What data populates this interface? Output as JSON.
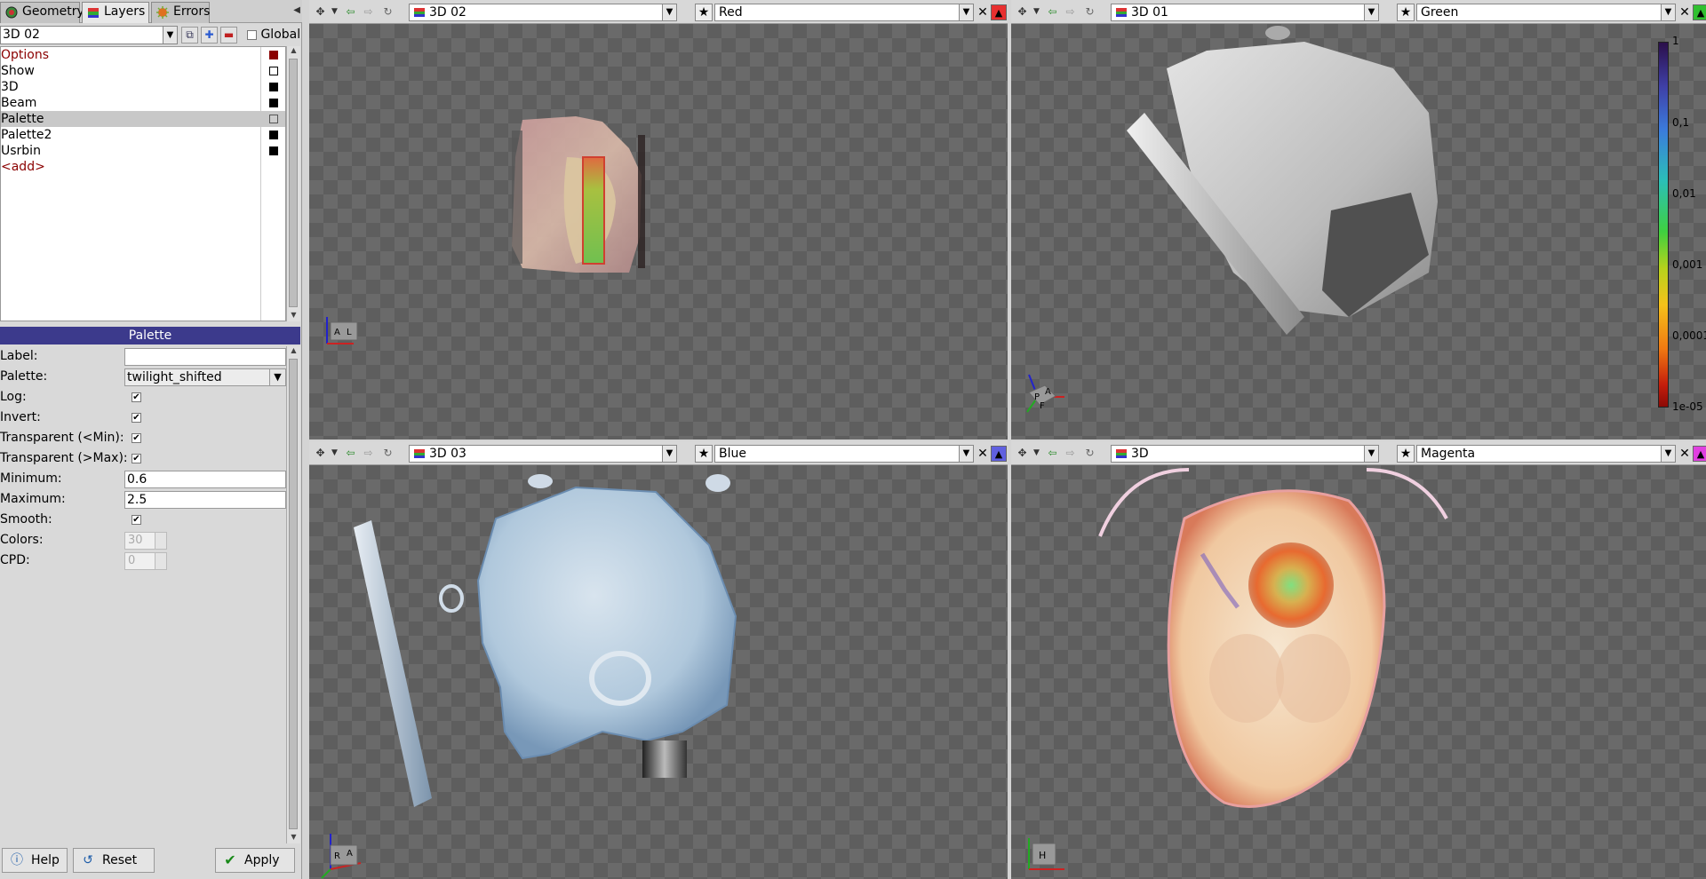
{
  "left_panel": {
    "tabs": [
      {
        "label": "Geometry",
        "icon": "geometry-icon"
      },
      {
        "label": "Layers",
        "icon": "layers-icon"
      },
      {
        "label": "Errors",
        "icon": "errors-icon"
      }
    ],
    "layer_select": "3D 02",
    "global_label": "Global",
    "layers": [
      {
        "label": "Options",
        "color": "#8b0000"
      },
      {
        "label": "Show",
        "color": "#ffffff"
      },
      {
        "label": "3D",
        "color": "#000000"
      },
      {
        "label": "Beam",
        "color": "#000000"
      },
      {
        "label": "Palette",
        "color": "#cccccc"
      },
      {
        "label": "Palette2",
        "color": "#000000"
      },
      {
        "label": "Usrbin",
        "color": "#000000"
      },
      {
        "label": "<add>",
        "color": ""
      }
    ],
    "panel_title": "Palette",
    "props": {
      "label_label": "Label:",
      "label_value": "",
      "palette_label": "Palette:",
      "palette_value": "twilight_shifted",
      "log_label": "Log:",
      "invert_label": "Invert:",
      "tmin_label": "Transparent (<Min):",
      "tmax_label": "Transparent (>Max):",
      "minimum_label": "Minimum:",
      "minimum_value": "0.6",
      "maximum_label": "Maximum:",
      "maximum_value": "2.5",
      "smooth_label": "Smooth:",
      "colors_label": "Colors:",
      "colors_value": "30",
      "cpd_label": "CPD:",
      "cpd_value": "0"
    },
    "buttons": {
      "help": "Help",
      "reset": "Reset",
      "apply": "Apply"
    }
  },
  "viewports": [
    {
      "name": "3D 02",
      "view": "Red",
      "color": "#e83030",
      "orient": [
        "A",
        "L"
      ]
    },
    {
      "name": "3D 01",
      "view": "Green",
      "color": "#30c030",
      "orient": [
        "P",
        "A",
        "F"
      ]
    },
    {
      "name": "3D 03",
      "view": "Blue",
      "color": "#6060e0",
      "orient": [
        "R",
        "A"
      ]
    },
    {
      "name": "3D",
      "view": "Magenta",
      "color": "#e040e0",
      "orient": [
        "H"
      ]
    }
  ],
  "colorbar": {
    "ticks": [
      "1",
      "0,1",
      "0,01",
      "0,001",
      "0,0001",
      "1e-05"
    ]
  }
}
